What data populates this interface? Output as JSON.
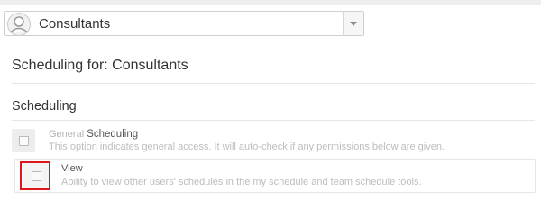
{
  "group_selector": {
    "selected": "Consultants"
  },
  "page": {
    "title": "Scheduling for: Consultants"
  },
  "section": {
    "title": "Scheduling"
  },
  "permissions": [
    {
      "prefix": "General",
      "name": "Scheduling",
      "description": "This option indicates general access. It will auto-check if any permissions below are given.",
      "checked": false
    },
    {
      "prefix": "",
      "name": "View",
      "description": "Ability to view other users' schedules in the my schedule and team schedule tools.",
      "checked": false
    }
  ],
  "colors": {
    "highlight": "#e0161d"
  }
}
